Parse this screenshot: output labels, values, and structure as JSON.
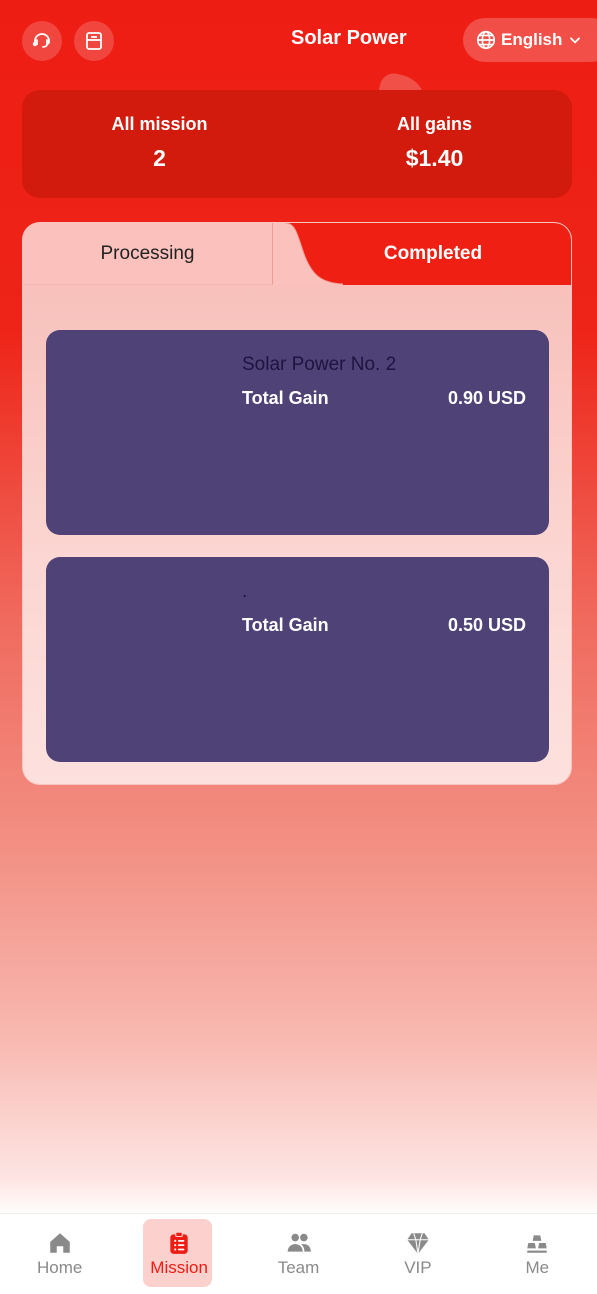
{
  "header": {
    "title": "Solar Power",
    "language": "English",
    "icons": [
      "headset-icon",
      "mailbox-icon",
      "globe-icon",
      "chevron-down-icon"
    ]
  },
  "stats": {
    "all_mission_label": "All mission",
    "all_mission_value": "2",
    "all_gains_label": "All gains",
    "all_gains_value": "$1.40"
  },
  "tabs": {
    "processing": "Processing",
    "completed": "Completed",
    "active": "Completed"
  },
  "missions": [
    {
      "name": "Solar Power No. 2",
      "gain_label": "Total Gain",
      "gain_value": "0.90 USD"
    },
    {
      "name": ".",
      "gain_label": "Total Gain",
      "gain_value": "0.50 USD"
    }
  ],
  "nav": {
    "items": [
      {
        "label": "Home",
        "icon": "home-icon"
      },
      {
        "label": "Mission",
        "icon": "clipboard-list-icon"
      },
      {
        "label": "Team",
        "icon": "team-icon"
      },
      {
        "label": "VIP",
        "icon": "diamond-icon"
      },
      {
        "label": "Me",
        "icon": "gold-bars-icon"
      }
    ],
    "active": "Mission"
  },
  "colors": {
    "brand_red": "#ee1d14",
    "card_purple": "#4f4276",
    "nav_inactive": "#8a8a8a"
  }
}
